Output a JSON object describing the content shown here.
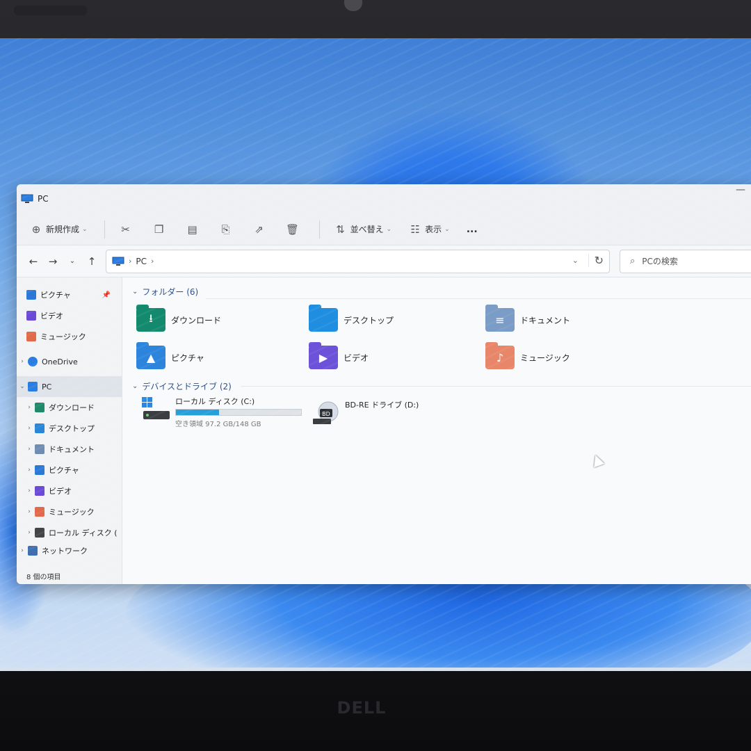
{
  "window": {
    "title": "PC"
  },
  "toolbar": {
    "new_label": "新規作成",
    "sort_label": "並べ替え",
    "view_label": "表示",
    "more_label": "..."
  },
  "address": {
    "location": "PC",
    "search_placeholder": "PCの検索"
  },
  "sidebar": {
    "quick": [
      {
        "label": "ピクチャ",
        "icon": "pictures-icon",
        "color": "#2b78d6",
        "pinned": true
      },
      {
        "label": "ビデオ",
        "icon": "videos-icon",
        "color": "#6a4ad6"
      },
      {
        "label": "ミュージック",
        "icon": "music-icon",
        "color": "#e06a4a"
      }
    ],
    "onedrive": "OneDrive",
    "pc": "PC",
    "pc_children": [
      {
        "label": "ダウンロード",
        "icon": "download-icon",
        "color": "#1f8a6a"
      },
      {
        "label": "デスクトップ",
        "icon": "desktop-icon",
        "color": "#2a86d8"
      },
      {
        "label": "ドキュメント",
        "icon": "documents-icon",
        "color": "#6d8db3"
      },
      {
        "label": "ピクチャ",
        "icon": "pictures-icon",
        "color": "#2b78d6"
      },
      {
        "label": "ビデオ",
        "icon": "videos-icon",
        "color": "#6a4ad6"
      },
      {
        "label": "ミュージック",
        "icon": "music-icon",
        "color": "#e06a4a"
      },
      {
        "label": "ローカル ディスク (",
        "icon": "drive-icon",
        "color": "#444"
      }
    ],
    "network": "ネットワーク"
  },
  "status": {
    "item_count": "8 個の項目"
  },
  "folders": {
    "header": "フォルダー (6)",
    "items": [
      {
        "label": "ダウンロード",
        "icon": "download-folder-icon",
        "color": "#138a6d",
        "glyph": "⭳"
      },
      {
        "label": "デスクトップ",
        "icon": "desktop-folder-icon",
        "color": "#1f8ee0",
        "glyph": ""
      },
      {
        "label": "ドキュメント",
        "icon": "documents-folder-icon",
        "color": "#7a9cc6",
        "glyph": "≡"
      },
      {
        "label": "ピクチャ",
        "icon": "pictures-folder-icon",
        "color": "#2c84dc",
        "glyph": "▲"
      },
      {
        "label": "ビデオ",
        "icon": "videos-folder-icon",
        "color": "#6b52d9",
        "glyph": "▶"
      },
      {
        "label": "ミュージック",
        "icon": "music-folder-icon",
        "color": "#e8866a",
        "glyph": "♪"
      }
    ]
  },
  "drives": {
    "header": "デバイスとドライブ (2)",
    "items": [
      {
        "label": "ローカル ディスク (C:)",
        "free": "空き領域 97.2 GB/148 GB",
        "used_fraction": 0.343,
        "icon": "local-disk-icon"
      },
      {
        "label": "BD-RE ドライブ (D:)",
        "icon": "bd-drive-icon",
        "badge": "BD"
      }
    ]
  },
  "taskbar": {
    "items": [
      {
        "icon": "windows-start-icon"
      },
      {
        "icon": "widgets-icon"
      },
      {
        "icon": "edge-icon"
      },
      {
        "icon": "settings-icon"
      },
      {
        "icon": "file-explorer-icon"
      }
    ],
    "tray_chevron": "^"
  },
  "device": {
    "logo": "DELL"
  }
}
